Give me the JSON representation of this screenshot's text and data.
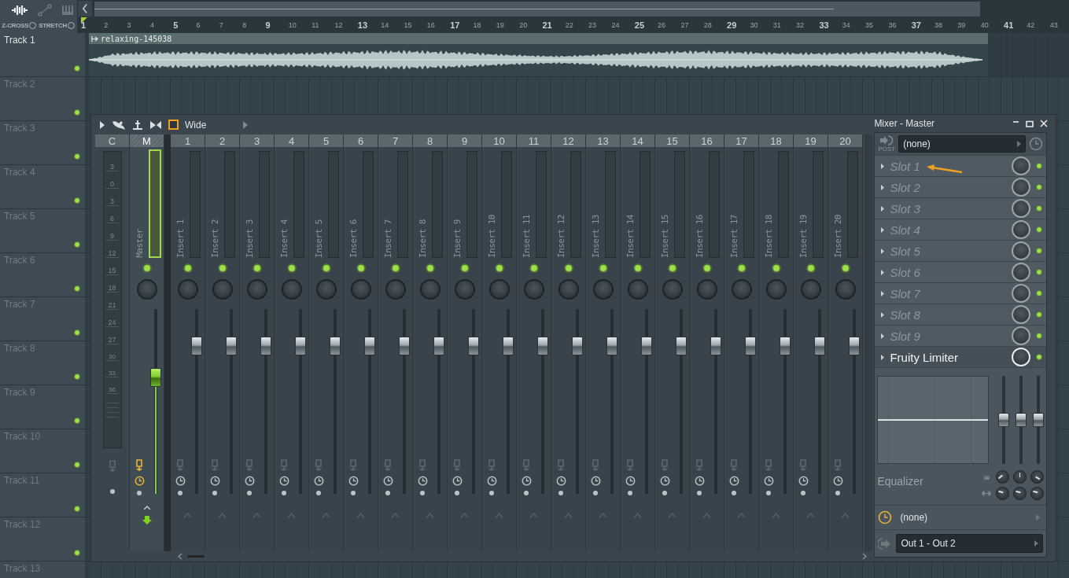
{
  "header": {
    "z_cross": "Z-CROSS",
    "stretch": "STRETCH"
  },
  "ruler": [
    "1",
    "2",
    "3",
    "4",
    "5",
    "6",
    "7",
    "8",
    "9",
    "10",
    "11",
    "12",
    "13",
    "14",
    "15",
    "16",
    "17",
    "18",
    "19",
    "20",
    "21",
    "22",
    "23",
    "24",
    "25",
    "26",
    "27",
    "28",
    "29",
    "30",
    "31",
    "32",
    "33",
    "34",
    "35",
    "36",
    "37",
    "38",
    "39",
    "40",
    "41",
    "42",
    "43"
  ],
  "tracks": [
    {
      "name": "Track 1"
    },
    {
      "name": "Track 2"
    },
    {
      "name": "Track 3"
    },
    {
      "name": "Track 4"
    },
    {
      "name": "Track 5"
    },
    {
      "name": "Track 6"
    },
    {
      "name": "Track 7"
    },
    {
      "name": "Track 8"
    },
    {
      "name": "Track 9"
    },
    {
      "name": "Track 10"
    },
    {
      "name": "Track 11"
    },
    {
      "name": "Track 12"
    },
    {
      "name": "Track 13"
    }
  ],
  "clip": {
    "name": "relaxing-145038"
  },
  "mixer": {
    "preset": "Wide",
    "title": "Mixer - Master",
    "meter_scale": [
      "3",
      "0",
      "3",
      "6",
      "9",
      "12",
      "15",
      "18",
      "21",
      "24",
      "27",
      "30",
      "33",
      "36"
    ],
    "strips": [
      {
        "kind": "current",
        "label": "C",
        "selected": false
      },
      {
        "kind": "master",
        "label": "M",
        "name": "Master",
        "selected": true,
        "level": 0.63
      },
      {
        "kind": "insert",
        "label": "1",
        "name": "Insert 1",
        "selected": false,
        "level": 0.8
      },
      {
        "kind": "insert",
        "label": "2",
        "name": "Insert 2",
        "selected": false,
        "level": 0.8
      },
      {
        "kind": "insert",
        "label": "3",
        "name": "Insert 3",
        "selected": false,
        "level": 0.8
      },
      {
        "kind": "insert",
        "label": "4",
        "name": "Insert 4",
        "selected": false,
        "level": 0.8
      },
      {
        "kind": "insert",
        "label": "5",
        "name": "Insert 5",
        "selected": false,
        "level": 0.8
      },
      {
        "kind": "insert",
        "label": "6",
        "name": "Insert 6",
        "selected": false,
        "level": 0.8
      },
      {
        "kind": "insert",
        "label": "7",
        "name": "Insert 7",
        "selected": false,
        "level": 0.8
      },
      {
        "kind": "insert",
        "label": "8",
        "name": "Insert 8",
        "selected": false,
        "level": 0.8
      },
      {
        "kind": "insert",
        "label": "9",
        "name": "Insert 9",
        "selected": false,
        "level": 0.8
      },
      {
        "kind": "insert",
        "label": "10",
        "name": "Insert 10",
        "selected": false,
        "level": 0.8
      },
      {
        "kind": "insert",
        "label": "11",
        "name": "Insert 11",
        "selected": false,
        "level": 0.8
      },
      {
        "kind": "insert",
        "label": "12",
        "name": "Insert 12",
        "selected": false,
        "level": 0.8
      },
      {
        "kind": "insert",
        "label": "13",
        "name": "Insert 13",
        "selected": false,
        "level": 0.8
      },
      {
        "kind": "insert",
        "label": "14",
        "name": "Insert 14",
        "selected": false,
        "level": 0.8
      },
      {
        "kind": "insert",
        "label": "15",
        "name": "Insert 15",
        "selected": false,
        "level": 0.8
      },
      {
        "kind": "insert",
        "label": "16",
        "name": "Insert 16",
        "selected": false,
        "level": 0.8
      },
      {
        "kind": "insert",
        "label": "17",
        "name": "Insert 17",
        "selected": false,
        "level": 0.8
      },
      {
        "kind": "insert",
        "label": "18",
        "name": "Insert 18",
        "selected": false,
        "level": 0.8
      },
      {
        "kind": "insert",
        "label": "19",
        "name": "Insert 19",
        "selected": false,
        "level": 0.8
      },
      {
        "kind": "insert",
        "label": "20",
        "name": "Insert 20",
        "selected": false,
        "level": 0.8
      }
    ],
    "post_label": "POST",
    "input": "(none)",
    "slots": [
      {
        "kind": "empty",
        "name": "Slot 1"
      },
      {
        "kind": "empty",
        "name": "Slot 2"
      },
      {
        "kind": "empty",
        "name": "Slot 3"
      },
      {
        "kind": "empty",
        "name": "Slot 4"
      },
      {
        "kind": "empty",
        "name": "Slot 5"
      },
      {
        "kind": "empty",
        "name": "Slot 6"
      },
      {
        "kind": "empty",
        "name": "Slot 7"
      },
      {
        "kind": "empty",
        "name": "Slot 8"
      },
      {
        "kind": "empty",
        "name": "Slot 9"
      },
      {
        "kind": "plugin",
        "name": "Fruity Limiter"
      }
    ],
    "eq_label": "Equalizer",
    "eq_bands": [
      {
        "level": 0.5
      },
      {
        "level": 0.5
      },
      {
        "level": 0.5
      }
    ],
    "sidechain": "(none)",
    "output": "Out 1 - Out 2"
  }
}
